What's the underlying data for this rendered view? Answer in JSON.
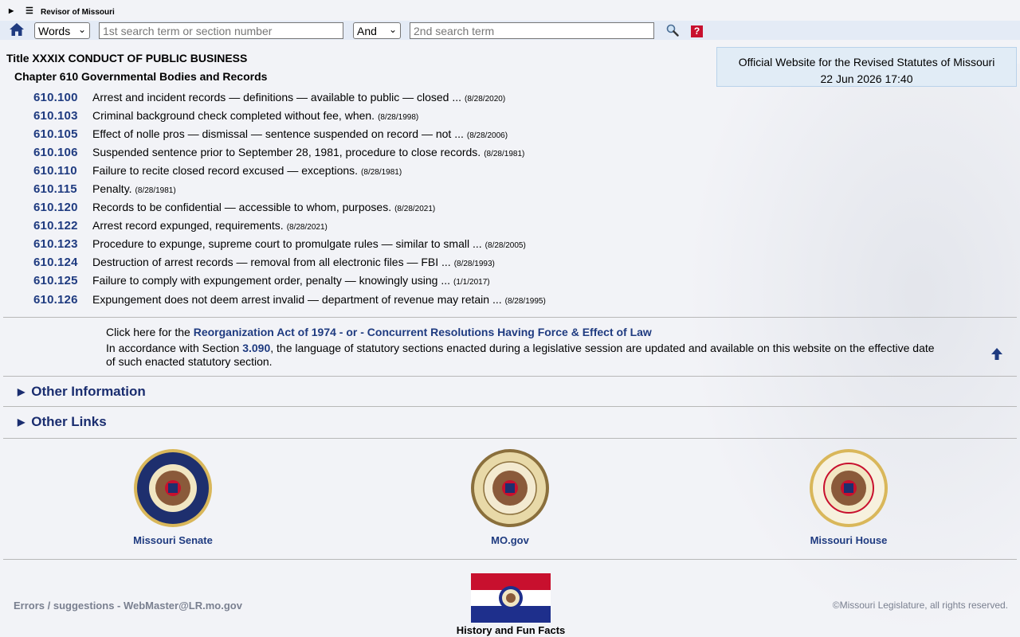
{
  "header": {
    "site_name": "Revisor of Missouri",
    "mode_select": "Words",
    "search1_placeholder": "1st search term or section number",
    "bool_select": "And",
    "search2_placeholder": "2nd search term",
    "help_glyph": "?"
  },
  "official": {
    "line1": "Official Website for the Revised Statutes of Missouri",
    "datetime": "22 Jun 2026 17:40"
  },
  "title": "Title XXXIX CONDUCT OF PUBLIC BUSINESS",
  "chapter": "Chapter 610 Governmental Bodies and Records",
  "sections": [
    {
      "num": "610.100",
      "desc": "Arrest and incident records — definitions — available to public — closed ...",
      "date": "(8/28/2020)"
    },
    {
      "num": "610.103",
      "desc": "Criminal background check completed without fee, when.",
      "date": "(8/28/1998)"
    },
    {
      "num": "610.105",
      "desc": "Effect of nolle pros — dismissal — sentence suspended on record — not ...",
      "date": "(8/28/2006)"
    },
    {
      "num": "610.106",
      "desc": "Suspended sentence prior to September 28, 1981, procedure to close records.",
      "date": "(8/28/1981)"
    },
    {
      "num": "610.110",
      "desc": "Failure to recite closed record excused — exceptions.",
      "date": "(8/28/1981)"
    },
    {
      "num": "610.115",
      "desc": "Penalty.",
      "date": "(8/28/1981)"
    },
    {
      "num": "610.120",
      "desc": "Records to be confidential — accessible to whom, purposes.",
      "date": "(8/28/2021)"
    },
    {
      "num": "610.122",
      "desc": "Arrest record expunged, requirements.",
      "date": "(8/28/2021)"
    },
    {
      "num": "610.123",
      "desc": "Procedure to expunge, supreme court to promulgate rules — similar to small ...",
      "date": "(8/28/2005)"
    },
    {
      "num": "610.124",
      "desc": "Destruction of arrest records — removal from all electronic files — FBI ...",
      "date": "(8/28/1993)"
    },
    {
      "num": "610.125",
      "desc": "Failure to comply with expungement order, penalty — knowingly using ...",
      "date": "(1/1/2017)"
    },
    {
      "num": "610.126",
      "desc": "Expungement does not deem arrest invalid — department of revenue may retain ...",
      "date": "(8/28/1995)"
    }
  ],
  "reorg": {
    "prefix": "Click here for the",
    "link": "Reorganization Act of 1974 - or - Concurrent Resolutions Having Force & Effect of Law",
    "para_start": "In accordance with Section",
    "section_ref": "3.090",
    "para_end": ", the language of statutory sections enacted during a legislative session are updated and available on this website on the effective date of such enacted statutory section."
  },
  "details": {
    "other_info": "Other Information",
    "other_links": "Other Links"
  },
  "seals": [
    {
      "label": "Missouri Senate"
    },
    {
      "label": "MO.gov"
    },
    {
      "label": "Missouri House"
    }
  ],
  "footer": {
    "errors": "Errors / suggestions - WebMaster@LR.mo.gov",
    "copyright": "©Missouri Legislature, all rights reserved.",
    "flag_label": "History and Fun Facts"
  },
  "colors": {
    "link_blue": "#1f3b80",
    "search_bar_bg": "#e4ebf6",
    "official_bg": "#e1ecf6",
    "help_red": "#c8102e"
  }
}
